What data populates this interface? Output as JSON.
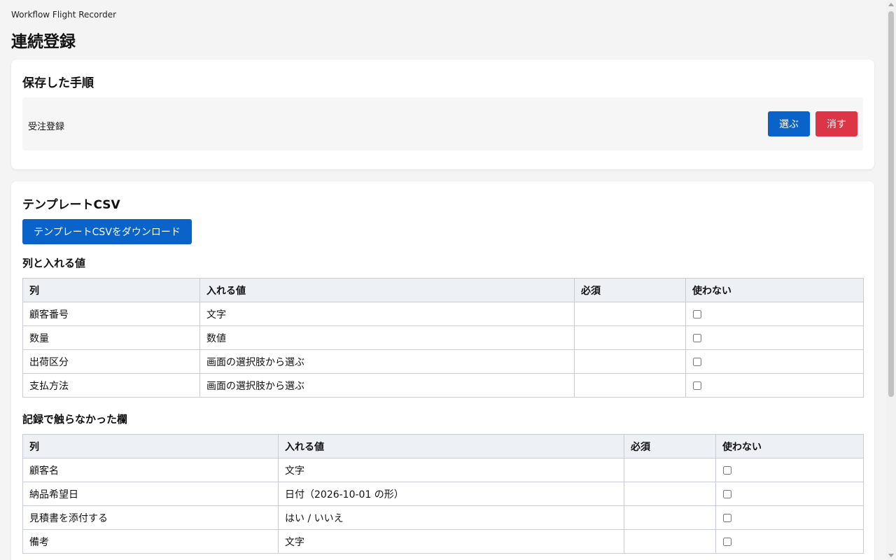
{
  "app": {
    "title": "Workflow Flight Recorder"
  },
  "page": {
    "title": "連続登録"
  },
  "saved_procedures": {
    "heading": "保存した手順",
    "items": [
      {
        "name": "受注登録",
        "select_label": "選ぶ",
        "delete_label": "消す"
      }
    ]
  },
  "template": {
    "heading": "テンプレートCSV",
    "download_label": "テンプレートCSVをダウンロード",
    "columns_heading": "列と入れる値",
    "headers": [
      "列",
      "入れる値",
      "必須",
      "使わない"
    ],
    "columns": [
      {
        "name": "顧客番号",
        "value": "文字",
        "required": "",
        "unused": false
      },
      {
        "name": "数量",
        "value": "数値",
        "required": "",
        "unused": false
      },
      {
        "name": "出荷区分",
        "value": "画面の選択肢から選ぶ",
        "required": "",
        "unused": false
      },
      {
        "name": "支払方法",
        "value": "画面の選択肢から選ぶ",
        "required": "",
        "unused": false
      }
    ],
    "untouched_heading": "記録で触らなかった欄",
    "untouched": [
      {
        "name": "顧客名",
        "value": "文字",
        "required": "",
        "unused": false
      },
      {
        "name": "納品希望日",
        "value": "日付（2026-10-01 の形）",
        "required": "",
        "unused": false
      },
      {
        "name": "見積書を添付する",
        "value": "はい / いいえ",
        "required": "",
        "unused": false
      },
      {
        "name": "備考",
        "value": "文字",
        "required": "",
        "unused": false
      }
    ]
  }
}
